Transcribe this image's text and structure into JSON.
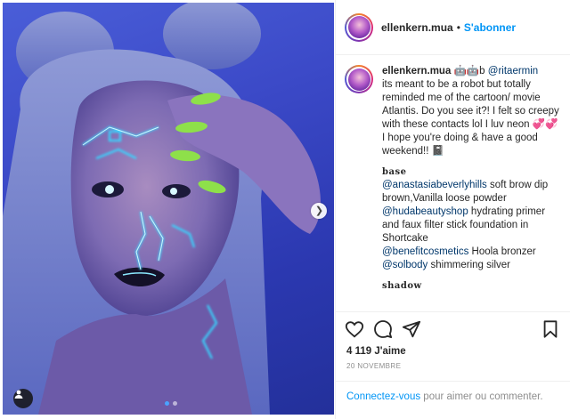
{
  "post": {
    "username": "ellenkern.mua",
    "separator": "•",
    "follow_label": "S'abonner",
    "caption": {
      "author": "ellenkern.mua",
      "emoji_after_author": "🤖🤖b",
      "mention_1": "@ritaermin",
      "body_1": "its meant to be a robot but totally reminded me of the cartoon/ movie Atlantis. Do you see it?! I felt so creepy with these contacts lol I luv neon 💞💞\nI hope you're doing & have a good weekend!! 📓",
      "section_base_title": "base",
      "base_lines": [
        {
          "mention": "@anastasiabeverlyhills",
          "text": " soft brow dip brown,Vanilla loose powder"
        },
        {
          "mention": "@hudabeautyshop",
          "text": " hydrating primer and faux filter stick foundation in Shortcake"
        },
        {
          "mention": "@benefitcosmetics",
          "text": " Hoola bronzer"
        },
        {
          "mention": "@solbody",
          "text": " shimmering silver"
        }
      ],
      "section_shadow_title": "shadow"
    },
    "likes_text": "4 119 J'aime",
    "date_text": "20 NOVEMBRE",
    "login_link": "Connectez-vous",
    "login_rest": " pour aimer ou commenter."
  },
  "icons": {
    "like": "heart-icon",
    "comment": "comment-icon",
    "share": "share-icon",
    "save": "bookmark-icon",
    "next": "chevron-right-icon",
    "tag": "user-tag-icon"
  },
  "colors": {
    "accent": "#0095f6",
    "mention": "#00376b",
    "muted": "#8e8e8e",
    "neon": "#39d6ff",
    "nails": "#8ee04a"
  }
}
